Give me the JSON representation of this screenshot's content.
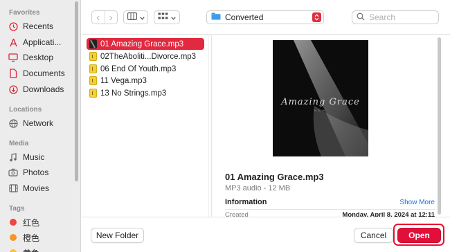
{
  "sidebar": {
    "favorites_title": "Favorites",
    "favorites": [
      {
        "label": "Recents",
        "icon": "clock-icon"
      },
      {
        "label": "Applicati...",
        "icon": "applications-icon"
      },
      {
        "label": "Desktop",
        "icon": "desktop-icon"
      },
      {
        "label": "Documents",
        "icon": "document-icon"
      },
      {
        "label": "Downloads",
        "icon": "download-icon"
      }
    ],
    "locations_title": "Locations",
    "locations": [
      {
        "label": "Network",
        "icon": "globe-icon"
      }
    ],
    "media_title": "Media",
    "media": [
      {
        "label": "Music",
        "icon": "music-note-icon"
      },
      {
        "label": "Photos",
        "icon": "camera-icon"
      },
      {
        "label": "Movies",
        "icon": "film-icon"
      }
    ],
    "tags_title": "Tags",
    "tags": [
      {
        "label": "红色",
        "color": "#f0483e"
      },
      {
        "label": "橙色",
        "color": "#f7952c"
      },
      {
        "label": "黄色",
        "color": "#f5c533"
      }
    ]
  },
  "toolbar": {
    "back_glyph": "‹",
    "forward_glyph": "›",
    "location": "Converted",
    "search_placeholder": "Search"
  },
  "files": [
    {
      "name": "01 Amazing Grace.mp3",
      "selected": true,
      "icon": "album-art-icon"
    },
    {
      "name": "02TheAboliti...Divorce.mp3",
      "selected": false,
      "icon": "mp3-file-icon"
    },
    {
      "name": "06 End Of Youth.mp3",
      "selected": false,
      "icon": "mp3-file-icon"
    },
    {
      "name": "11 Vega.mp3",
      "selected": false,
      "icon": "mp3-file-icon"
    },
    {
      "name": "13 No Strings.mp3",
      "selected": false,
      "icon": "mp3-file-icon"
    }
  ],
  "preview": {
    "art_title": "Amazing Grace",
    "art_subtitle": "N.E.W.",
    "name": "01 Amazing Grace.mp3",
    "kind": "MP3 audio - 12 MB",
    "info_heading": "Information",
    "show_more": "Show More",
    "created_label": "Created",
    "created_value": "Monday, April 8, 2024 at 12:11"
  },
  "buttons": {
    "new_folder": "New Folder",
    "cancel": "Cancel",
    "open": "Open"
  },
  "colors": {
    "accent": "#e1293f",
    "link": "#1f6fd1",
    "focus_ring": "#e8102f"
  }
}
